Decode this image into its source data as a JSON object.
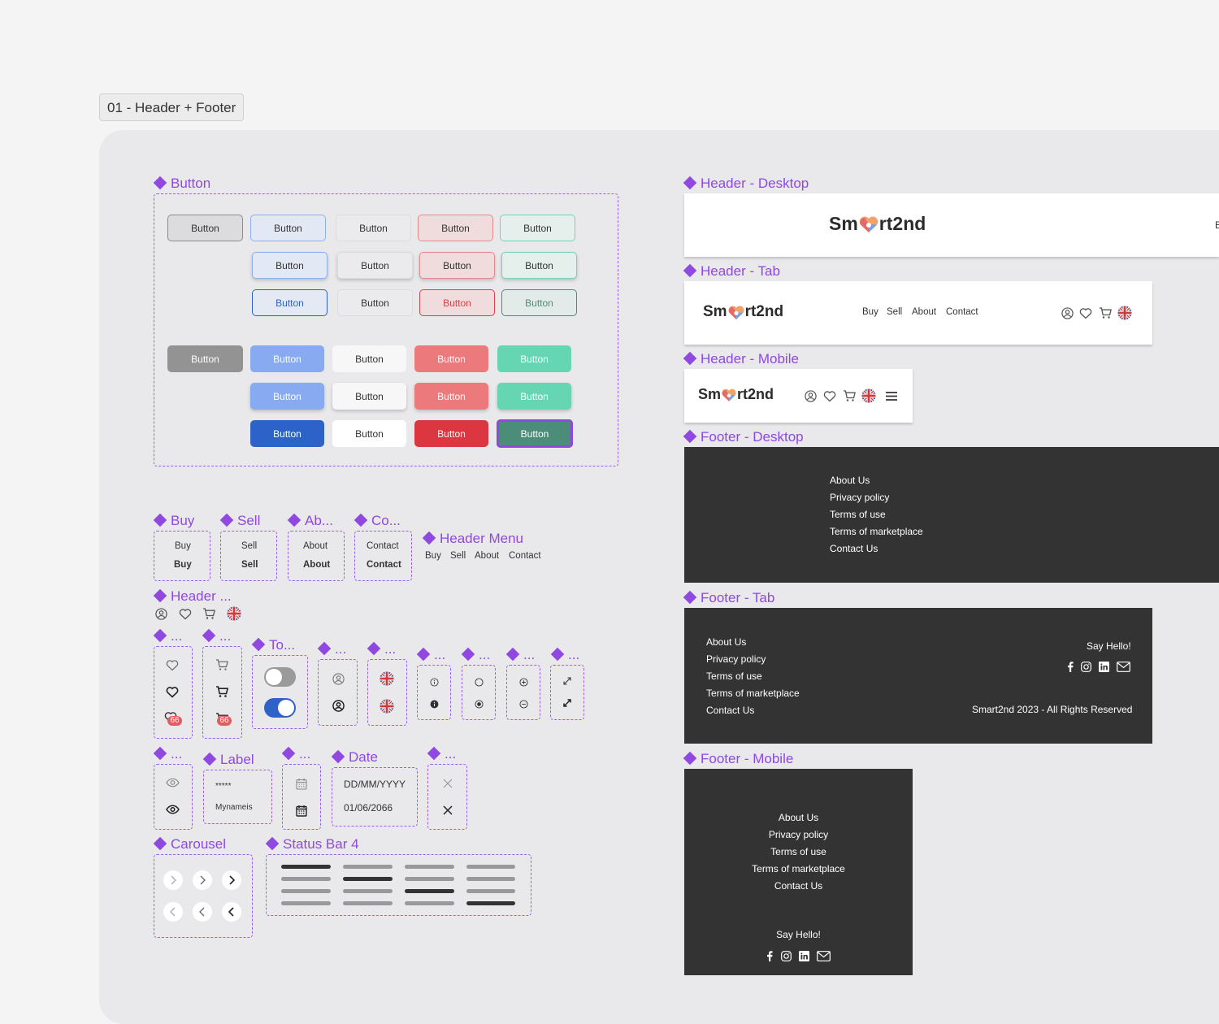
{
  "frame": {
    "label": "01 - Header + Footer"
  },
  "components": {
    "button": "Button",
    "buy": "Buy",
    "sell": "Sell",
    "about": "Ab...",
    "contact": "Co...",
    "header_menu": "Header Menu",
    "header_icons": "Header ...",
    "dots": "...",
    "toggle": "To...",
    "label": "Label",
    "date": "Date",
    "carousel": "Carousel",
    "status_bar": "Status Bar 4",
    "header_desktop": "Header - Desktop",
    "header_tab": "Header - Tab",
    "header_mobile": "Header - Mobile",
    "footer_desktop": "Footer - Desktop",
    "footer_tab": "Footer - Tab",
    "footer_mobile": "Footer - Mobile"
  },
  "buttons": {
    "label": "Button"
  },
  "nav": {
    "buy": "Buy",
    "sell": "Sell",
    "about": "About",
    "contact": "Contact"
  },
  "logo": {
    "before": "Sm",
    "after": "rt2nd",
    "partial_right": "E"
  },
  "badge": {
    "count": "66"
  },
  "fields": {
    "password_mask": "*****",
    "username": "Mynameis",
    "date_placeholder": "DD/MM/YYYY",
    "date_value": "01/06/2066"
  },
  "footer": {
    "links": [
      "About Us",
      "Privacy policy",
      "Terms of use",
      "Terms of marketplace",
      "Contact Us"
    ],
    "say_hello": "Say Hello!",
    "copyright": "Smart2nd 2023 - All Rights Reserved"
  },
  "colors": {
    "accent": "#8f48e0",
    "primary_blue": "#2d63c8",
    "red": "#dc3740",
    "green": "#4b8d78",
    "footer_bg": "#333333"
  },
  "icons": [
    "user-icon",
    "heart-icon",
    "cart-icon",
    "uk-flag-icon",
    "menu-icon",
    "info-icon",
    "radio-icon",
    "zoom-icon",
    "expand-icon",
    "eye-icon",
    "calendar-icon",
    "close-icon",
    "chevron-right-icon",
    "chevron-left-icon",
    "facebook-icon",
    "instagram-icon",
    "linkedin-icon",
    "mail-icon"
  ]
}
